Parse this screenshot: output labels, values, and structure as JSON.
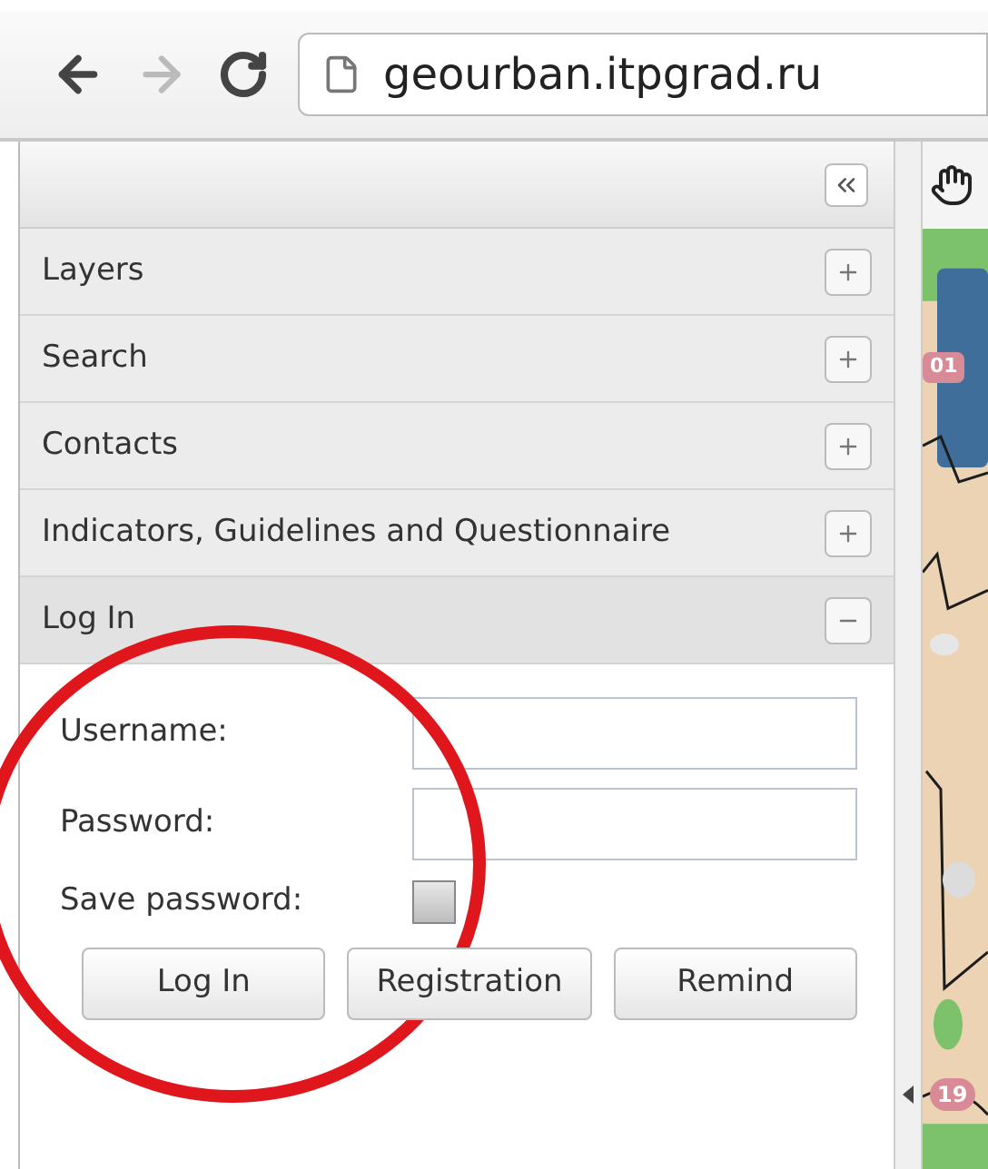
{
  "browser": {
    "url": "geourban.itpgrad.ru"
  },
  "sections": [
    {
      "title": "Layers",
      "expanded": false
    },
    {
      "title": "Search",
      "expanded": false
    },
    {
      "title": "Contacts",
      "expanded": false
    },
    {
      "title": "Indicators, Guidelines and Questionnaire",
      "expanded": false
    },
    {
      "title": "Log In",
      "expanded": true
    }
  ],
  "login_form": {
    "fields": [
      {
        "label": "Username:"
      },
      {
        "label": "Password:"
      }
    ],
    "save_password": {
      "label": "Save password:",
      "checked": false
    },
    "buttons": [
      "Log In",
      "Registration",
      "Remind"
    ]
  },
  "map": {
    "badges": [
      "01",
      "19"
    ]
  }
}
